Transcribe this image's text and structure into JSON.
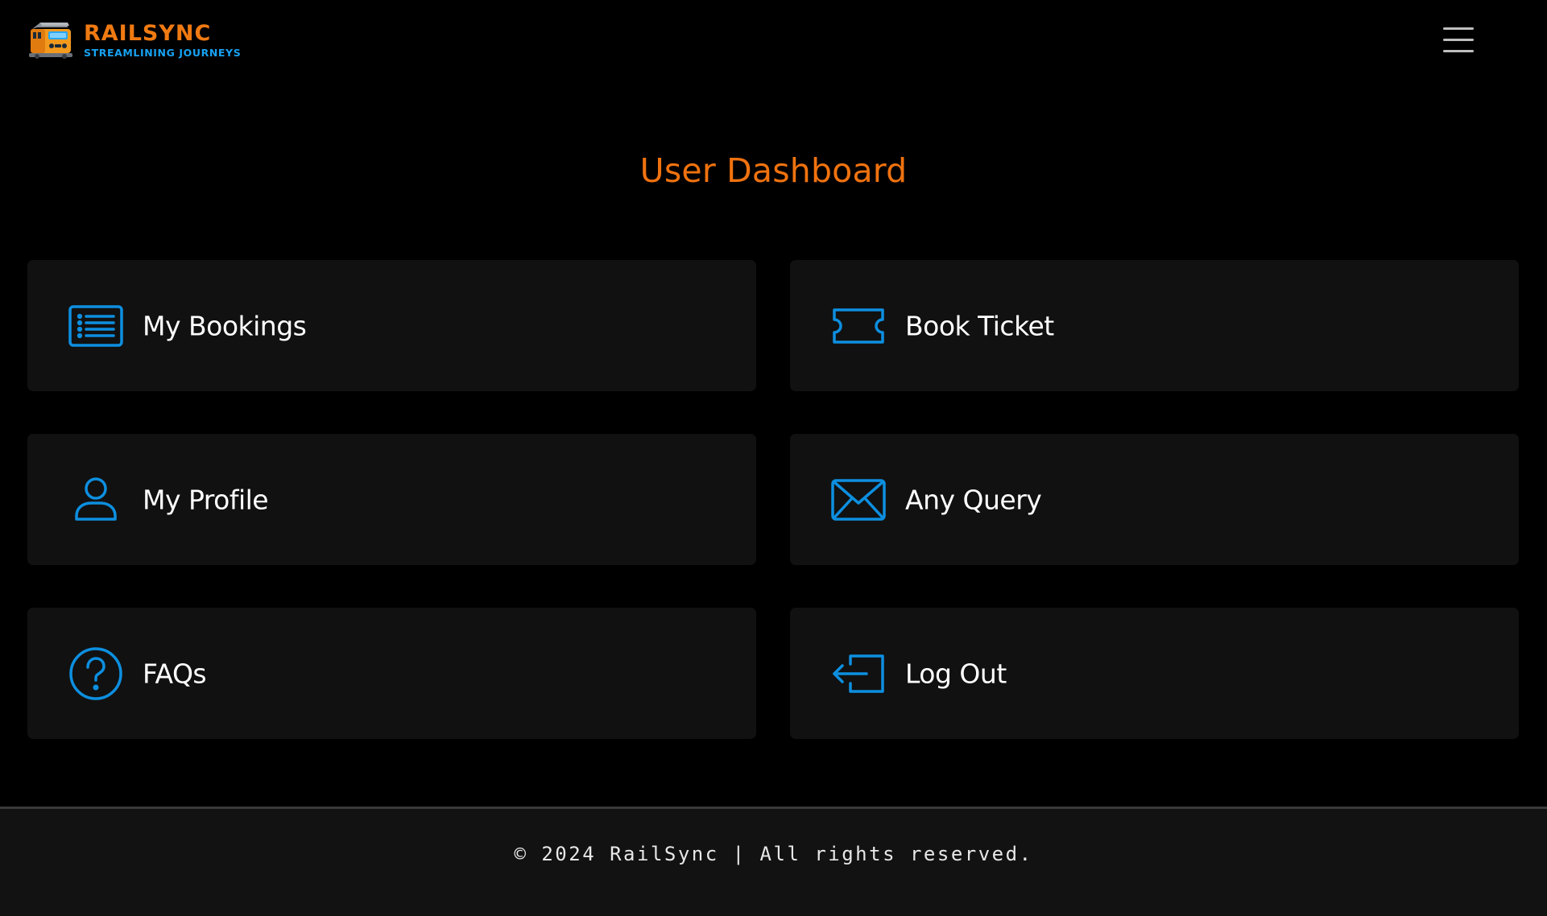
{
  "brand": {
    "name": "RAILSYNC",
    "tagline": "STREAMLINING JOURNEYS",
    "logo_icon": "train-icon",
    "primary_color": "#f07a12",
    "accent_color": "#17a2f2"
  },
  "header": {
    "menu_icon": "hamburger-menu-icon"
  },
  "main": {
    "title": "User Dashboard",
    "title_color": "#f0720f",
    "cards": [
      {
        "label": "My Bookings",
        "icon": "list-icon"
      },
      {
        "label": "Book Ticket",
        "icon": "ticket-icon"
      },
      {
        "label": "My Profile",
        "icon": "user-icon"
      },
      {
        "label": "Any Query",
        "icon": "envelope-icon"
      },
      {
        "label": "FAQs",
        "icon": "question-circle-icon"
      },
      {
        "label": "Log Out",
        "icon": "logout-icon"
      }
    ],
    "icon_color": "#0d8fe0"
  },
  "footer": {
    "text": "© 2024 RailSync | All rights reserved."
  }
}
